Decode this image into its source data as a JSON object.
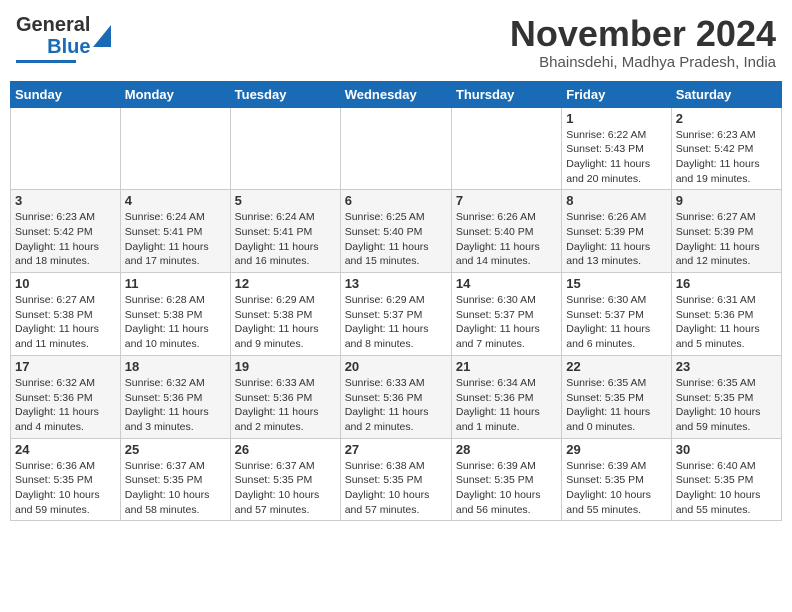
{
  "header": {
    "logo_line1": "General",
    "logo_line2": "Blue",
    "month_title": "November 2024",
    "subtitle": "Bhainsdehi, Madhya Pradesh, India"
  },
  "calendar": {
    "days_of_week": [
      "Sunday",
      "Monday",
      "Tuesday",
      "Wednesday",
      "Thursday",
      "Friday",
      "Saturday"
    ],
    "weeks": [
      [
        {
          "day": "",
          "info": ""
        },
        {
          "day": "",
          "info": ""
        },
        {
          "day": "",
          "info": ""
        },
        {
          "day": "",
          "info": ""
        },
        {
          "day": "",
          "info": ""
        },
        {
          "day": "1",
          "info": "Sunrise: 6:22 AM\nSunset: 5:43 PM\nDaylight: 11 hours and 20 minutes."
        },
        {
          "day": "2",
          "info": "Sunrise: 6:23 AM\nSunset: 5:42 PM\nDaylight: 11 hours and 19 minutes."
        }
      ],
      [
        {
          "day": "3",
          "info": "Sunrise: 6:23 AM\nSunset: 5:42 PM\nDaylight: 11 hours and 18 minutes."
        },
        {
          "day": "4",
          "info": "Sunrise: 6:24 AM\nSunset: 5:41 PM\nDaylight: 11 hours and 17 minutes."
        },
        {
          "day": "5",
          "info": "Sunrise: 6:24 AM\nSunset: 5:41 PM\nDaylight: 11 hours and 16 minutes."
        },
        {
          "day": "6",
          "info": "Sunrise: 6:25 AM\nSunset: 5:40 PM\nDaylight: 11 hours and 15 minutes."
        },
        {
          "day": "7",
          "info": "Sunrise: 6:26 AM\nSunset: 5:40 PM\nDaylight: 11 hours and 14 minutes."
        },
        {
          "day": "8",
          "info": "Sunrise: 6:26 AM\nSunset: 5:39 PM\nDaylight: 11 hours and 13 minutes."
        },
        {
          "day": "9",
          "info": "Sunrise: 6:27 AM\nSunset: 5:39 PM\nDaylight: 11 hours and 12 minutes."
        }
      ],
      [
        {
          "day": "10",
          "info": "Sunrise: 6:27 AM\nSunset: 5:38 PM\nDaylight: 11 hours and 11 minutes."
        },
        {
          "day": "11",
          "info": "Sunrise: 6:28 AM\nSunset: 5:38 PM\nDaylight: 11 hours and 10 minutes."
        },
        {
          "day": "12",
          "info": "Sunrise: 6:29 AM\nSunset: 5:38 PM\nDaylight: 11 hours and 9 minutes."
        },
        {
          "day": "13",
          "info": "Sunrise: 6:29 AM\nSunset: 5:37 PM\nDaylight: 11 hours and 8 minutes."
        },
        {
          "day": "14",
          "info": "Sunrise: 6:30 AM\nSunset: 5:37 PM\nDaylight: 11 hours and 7 minutes."
        },
        {
          "day": "15",
          "info": "Sunrise: 6:30 AM\nSunset: 5:37 PM\nDaylight: 11 hours and 6 minutes."
        },
        {
          "day": "16",
          "info": "Sunrise: 6:31 AM\nSunset: 5:36 PM\nDaylight: 11 hours and 5 minutes."
        }
      ],
      [
        {
          "day": "17",
          "info": "Sunrise: 6:32 AM\nSunset: 5:36 PM\nDaylight: 11 hours and 4 minutes."
        },
        {
          "day": "18",
          "info": "Sunrise: 6:32 AM\nSunset: 5:36 PM\nDaylight: 11 hours and 3 minutes."
        },
        {
          "day": "19",
          "info": "Sunrise: 6:33 AM\nSunset: 5:36 PM\nDaylight: 11 hours and 2 minutes."
        },
        {
          "day": "20",
          "info": "Sunrise: 6:33 AM\nSunset: 5:36 PM\nDaylight: 11 hours and 2 minutes."
        },
        {
          "day": "21",
          "info": "Sunrise: 6:34 AM\nSunset: 5:36 PM\nDaylight: 11 hours and 1 minute."
        },
        {
          "day": "22",
          "info": "Sunrise: 6:35 AM\nSunset: 5:35 PM\nDaylight: 11 hours and 0 minutes."
        },
        {
          "day": "23",
          "info": "Sunrise: 6:35 AM\nSunset: 5:35 PM\nDaylight: 10 hours and 59 minutes."
        }
      ],
      [
        {
          "day": "24",
          "info": "Sunrise: 6:36 AM\nSunset: 5:35 PM\nDaylight: 10 hours and 59 minutes."
        },
        {
          "day": "25",
          "info": "Sunrise: 6:37 AM\nSunset: 5:35 PM\nDaylight: 10 hours and 58 minutes."
        },
        {
          "day": "26",
          "info": "Sunrise: 6:37 AM\nSunset: 5:35 PM\nDaylight: 10 hours and 57 minutes."
        },
        {
          "day": "27",
          "info": "Sunrise: 6:38 AM\nSunset: 5:35 PM\nDaylight: 10 hours and 57 minutes."
        },
        {
          "day": "28",
          "info": "Sunrise: 6:39 AM\nSunset: 5:35 PM\nDaylight: 10 hours and 56 minutes."
        },
        {
          "day": "29",
          "info": "Sunrise: 6:39 AM\nSunset: 5:35 PM\nDaylight: 10 hours and 55 minutes."
        },
        {
          "day": "30",
          "info": "Sunrise: 6:40 AM\nSunset: 5:35 PM\nDaylight: 10 hours and 55 minutes."
        }
      ]
    ]
  }
}
